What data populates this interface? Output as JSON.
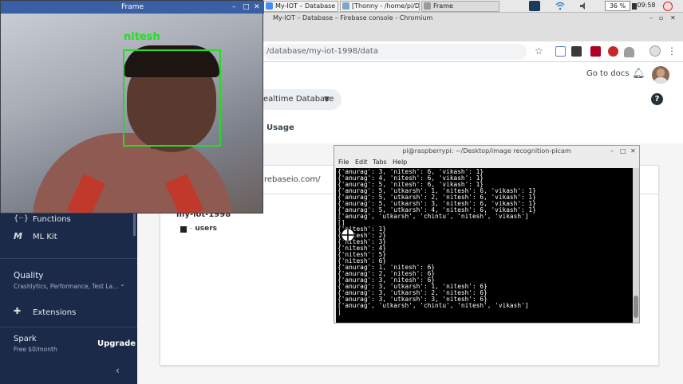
{
  "taskbar": {
    "tasks": [
      {
        "label": "My-IOT – Database – Fi..."
      },
      {
        "label": "[Thonny - /home/pi/Des..."
      },
      {
        "label": "Frame"
      }
    ],
    "tray": {
      "battery": "36 %",
      "time": "09:58"
    }
  },
  "browser": {
    "title": "My-IOT – Database – Firebase console - Chromium",
    "url": "/database/my-iot-1998/data"
  },
  "firebase": {
    "go_to_docs": "Go to docs",
    "db_selector": "ealtime Database",
    "usage_tab": "Usage",
    "db_url_fragment": "rebaseio.com/",
    "tree": {
      "root": "my-iot-1998",
      "child": "users"
    },
    "sidebar": {
      "items": [
        {
          "label": "Functions",
          "icon": "functions-icon"
        },
        {
          "label": "ML Kit",
          "icon": "ml-kit-icon"
        }
      ],
      "quality": {
        "title": "Quality",
        "subtitle": "Crashlytics, Performance, Test La..."
      },
      "extensions": {
        "label": "Extensions",
        "icon": "extensions-icon"
      },
      "plan": {
        "name": "Spark",
        "price": "Free $0/month",
        "upgrade": "Upgrade"
      }
    }
  },
  "frame": {
    "title": "Frame",
    "detected_label": "nitesh",
    "box_color": "#22dd22"
  },
  "terminal": {
    "title": "pi@raspberrypi: ~/Desktop/image recognition-picam",
    "menu": [
      "File",
      "Edit",
      "Tabs",
      "Help"
    ],
    "lines": [
      "{'anurag': 3, 'nitesh': 6, 'vikash': 1}",
      "{'anurag': 4, 'nitesh': 6, 'vikash': 1}",
      "{'anurag': 5, 'nitesh': 6, 'vikash': 1}",
      "{'anurag': 5, 'utkarsh': 1, 'nitesh': 6, 'vikash': 1}",
      "{'anurag': 5, 'utkarsh': 2, 'nitesh': 6, 'vikash': 1}",
      "{'anurag': 5, 'utkarsh': 3, 'nitesh': 6, 'vikash': 1}",
      "{'anurag': 5, 'utkarsh': 4, 'nitesh': 6, 'vikash': 1}",
      "['anurag', 'utkarsh', 'chintu', 'nitesh', 'vikash']",
      "[]",
      "{'nitesh': 1}",
      "{'nitesh': 2}",
      "{'nitesh': 3}",
      "{'nitesh': 4}",
      "{'nitesh': 5}",
      "{'nitesh': 6}",
      "{'anurag': 1, 'nitesh': 6}",
      "{'anurag': 2, 'nitesh': 6}",
      "{'anurag': 3, 'nitesh': 6}",
      "{'anurag': 3, 'utkarsh': 1, 'nitesh': 6}",
      "{'anurag': 3, 'utkarsh': 2, 'nitesh': 6}",
      "{'anurag': 3, 'utkarsh': 3, 'nitesh': 6}",
      "['anurag', 'utkarsh', 'chintu', 'nitesh', 'vikash']",
      "|"
    ]
  }
}
